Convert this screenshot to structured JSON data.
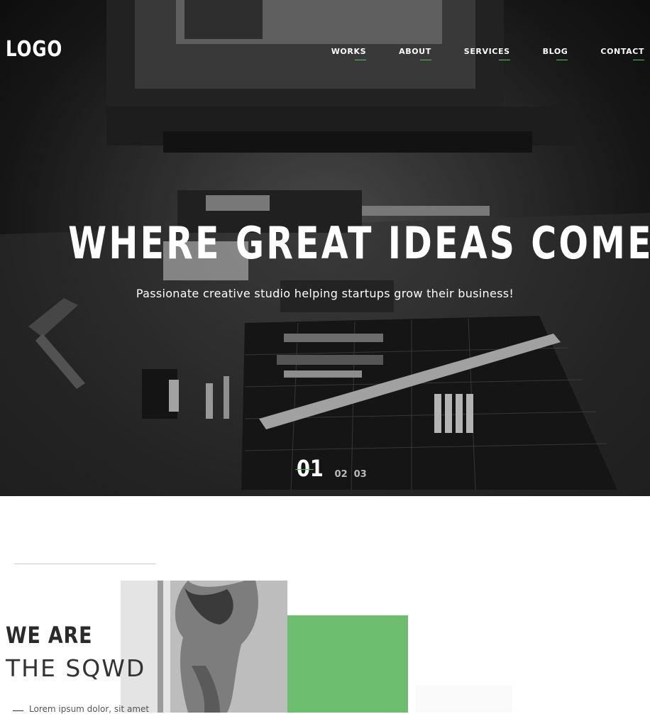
{
  "header": {
    "logo": "LOGO",
    "nav": [
      "WORKS",
      "ABOUT",
      "SERVICES",
      "BLOG",
      "CONTACT"
    ]
  },
  "hero": {
    "headline": "WHERE GREAT IDEAS COME TO LIFE",
    "subline": "Passionate creative studio helping startups grow their business!",
    "slides": [
      "01",
      "02",
      "03"
    ],
    "active_slide": "01"
  },
  "about": {
    "title_bold": "WE ARE",
    "title_light": "THE SQWD",
    "bullet": "Lorem ipsum dolor, sit amet"
  },
  "colors": {
    "accent": "#59c063",
    "green_block": "#6dbf6f"
  },
  "icons": {
    "hero_background": "workbench-photo",
    "about_photo": "portrait-photo"
  }
}
